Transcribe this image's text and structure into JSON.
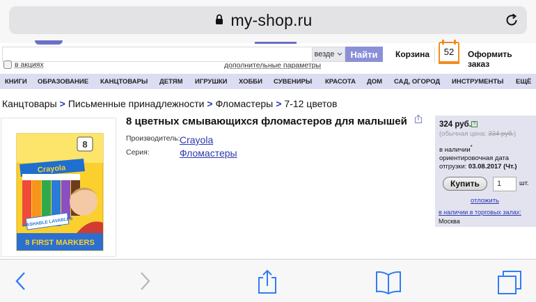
{
  "browser": {
    "url": "my-shop.ru"
  },
  "search": {
    "placeholder": "",
    "scope_label": "везде",
    "find_label": "Найти",
    "promo_label": "в акциях",
    "advanced_label": "дополнительные параметры"
  },
  "cart": {
    "label": "Корзина",
    "calendar_number": "52",
    "checkout_label": "Оформить заказ"
  },
  "categories": [
    "КНИГИ",
    "ОБРАЗОВАНИЕ",
    "КАНЦТОВАРЫ",
    "ДЕТЯМ",
    "ИГРУШКИ",
    "ХОББИ",
    "СУВЕНИРЫ",
    "КРАСОТА",
    "ДОМ",
    "САД, ОГОРОД",
    "ИНСТРУМЕНТЫ",
    "ЕЩЁ"
  ],
  "breadcrumb": [
    "Канцтовары",
    "Письменные принадлежности",
    "Фломастеры",
    "7-12 цветов"
  ],
  "breadcrumb_sep": ">",
  "product": {
    "title": "8 цветных смывающихся фломастеров для малышей",
    "manufacturer_label": "Производитель:",
    "manufacturer": "Crayola",
    "series_label": "Серия:",
    "series": "Фломастеры",
    "package": {
      "count": "8",
      "brand": "Crayola",
      "tag": "WASHABLE LAVABLES",
      "caption": "8 FIRST MARKERS"
    }
  },
  "price_panel": {
    "price": "324 руб.",
    "old_price_label": "(обычная цена:",
    "old_price": "334 руб.",
    "old_price_close": ")",
    "stock": "в наличии",
    "stock_mark": "*",
    "delivery_line1": "ориентировочная дата",
    "delivery_label": "отгрузки:",
    "delivery_date": "03.08.2017 (Чт.)",
    "buy_label": "Купить",
    "quantity": "1",
    "unit": "шт.",
    "defer_label": "отложить",
    "stores_label": "в наличии в торговых залах",
    "stores_suffix": ":",
    "city": "Москва"
  },
  "colors": {
    "accent": "#8a8fd8",
    "nav_bg": "#dcdcf2",
    "link": "#2d36b0",
    "calendar": "#f08c1e",
    "panel_bg": "#e3e3f0",
    "ios_blue": "#2f7cf6"
  },
  "toolbar": {
    "icons": [
      "back-icon",
      "forward-icon",
      "share-icon",
      "bookmarks-icon",
      "tabs-icon"
    ]
  }
}
